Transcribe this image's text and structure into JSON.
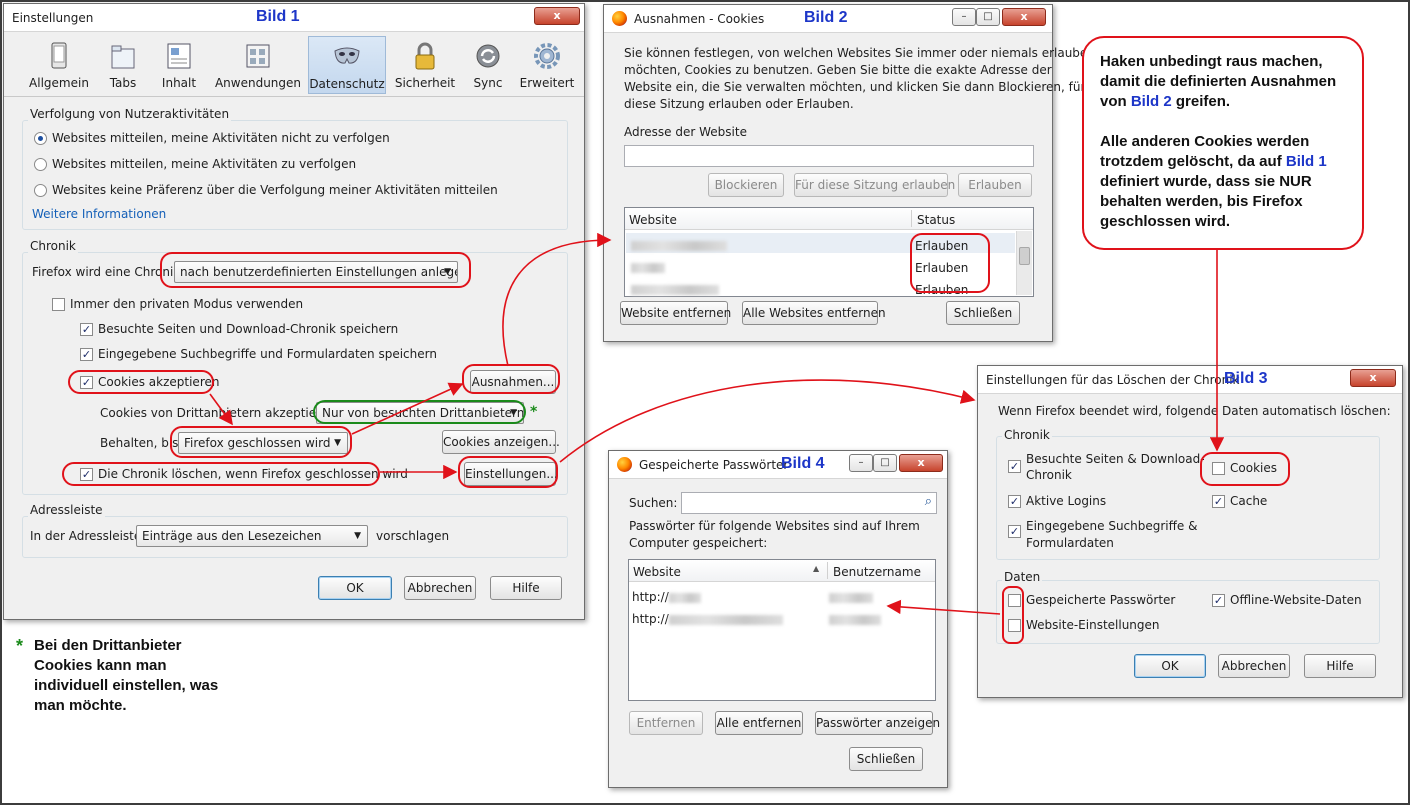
{
  "bild1": {
    "title": "Einstellungen",
    "bild_label": "Bild 1",
    "tabs": [
      {
        "label": "Allgemein",
        "icon": "general-icon"
      },
      {
        "label": "Tabs",
        "icon": "tabs-icon"
      },
      {
        "label": "Inhalt",
        "icon": "content-icon"
      },
      {
        "label": "Anwendungen",
        "icon": "applications-icon"
      },
      {
        "label": "Datenschutz",
        "icon": "privacy-mask-icon"
      },
      {
        "label": "Sicherheit",
        "icon": "lock-icon"
      },
      {
        "label": "Sync",
        "icon": "sync-icon"
      },
      {
        "label": "Erweitert",
        "icon": "gear-icon"
      }
    ],
    "tracking": {
      "group": "Verfolgung von Nutzeraktivitäten",
      "options": [
        "Websites mitteilen, meine Aktivitäten nicht zu verfolgen",
        "Websites mitteilen, meine Aktivitäten zu verfolgen",
        "Websites keine Präferenz über die Verfolgung meiner Aktivitäten mitteilen"
      ],
      "more_info": "Weitere Informationen"
    },
    "history": {
      "group": "Chronik",
      "firefox_will_label": "Firefox wird eine Chronik:",
      "firefox_will_value": "nach benutzerdefinierten Einstellungen anlegen",
      "private_mode": "Immer den privaten Modus verwenden",
      "visited_pages": "Besuchte Seiten und Download-Chronik speichern",
      "search_form": "Eingegebene Suchbegriffe und Formulardaten speichern",
      "accept_cookies": "Cookies akzeptieren",
      "exceptions_button": "Ausnahmen...",
      "third_party_label": "Cookies von Drittanbietern akzeptieren:",
      "third_party_value": "Nur von besuchten Drittanbietern",
      "keep_until_label": "Behalten, bis:",
      "keep_until_value": "Firefox geschlossen wird",
      "show_cookies_button": "Cookies anzeigen...",
      "clear_on_close": "Die Chronik löschen, wenn Firefox geschlossen wird",
      "settings_button": "Einstellungen..."
    },
    "address_bar": {
      "group": "Adressleiste",
      "label": "In der Adressleiste",
      "value": "Einträge aus den Lesezeichen",
      "suffix": "vorschlagen"
    },
    "buttons": {
      "ok": "OK",
      "cancel": "Abbrechen",
      "help": "Hilfe"
    },
    "green_star": "*"
  },
  "bild2": {
    "title": "Ausnahmen - Cookies",
    "bild_label": "Bild 2",
    "description": [
      "Sie können festlegen, von welchen Websites Sie immer oder niemals erlauben",
      "möchten, Cookies zu benutzen. Geben Sie bitte die exakte Adresse der",
      "Website ein, die Sie verwalten möchten, und klicken Sie dann Blockieren, für",
      "diese Sitzung erlauben oder Erlauben."
    ],
    "address_label": "Adresse der Website",
    "buttons": {
      "block": "Blockieren",
      "session": "Für diese Sitzung erlauben",
      "allow": "Erlauben"
    },
    "columns": {
      "website": "Website",
      "status": "Status"
    },
    "rows": [
      {
        "status": "Erlauben"
      },
      {
        "status": "Erlauben"
      },
      {
        "status": "Erlauben"
      }
    ],
    "bottom_buttons": {
      "remove": "Website entfernen",
      "remove_all": "Alle Websites entfernen",
      "close": "Schließen"
    }
  },
  "bild3": {
    "title": "Einstellungen für das Löschen der Chronik",
    "bild_label": "Bild 3",
    "intro": "Wenn Firefox beendet wird, folgende Daten automatisch löschen:",
    "history_group": "Chronik",
    "items": {
      "visited_1": "Besuchte Seiten & Download-",
      "visited_2": "Chronik",
      "cookies": "Cookies",
      "logins": "Aktive Logins",
      "cache": "Cache",
      "search_1": "Eingegebene Suchbegriffe &",
      "search_2": "Formulardaten"
    },
    "data_group": "Daten",
    "data_items": {
      "passwords": "Gespeicherte Passwörter",
      "offline": "Offline-Website-Daten",
      "site_settings": "Website-Einstellungen"
    },
    "buttons": {
      "ok": "OK",
      "cancel": "Abbrechen",
      "help": "Hilfe"
    }
  },
  "bild4": {
    "title": "Gespeicherte Passwörter",
    "bild_label": "Bild 4",
    "search_label": "Suchen:",
    "description_1": "Passwörter für folgende Websites sind auf Ihrem",
    "description_2": "Computer gespeichert:",
    "columns": {
      "website": "Website",
      "username": "Benutzername"
    },
    "rows": [
      {
        "site": "http://"
      },
      {
        "site": "http://"
      }
    ],
    "buttons": {
      "remove": "Entfernen",
      "remove_all": "Alle entfernen",
      "show_passwords": "Passwörter anzeigen",
      "close": "Schließen"
    }
  },
  "annotation": {
    "line1": "Haken unbedingt raus machen,",
    "line2": "damit die definierten Ausnahmen",
    "line3a": "von ",
    "line3b": "Bild 2",
    "line3c": " greifen.",
    "line4": "Alle anderen Cookies werden",
    "line5a": "trotzdem gelöscht, da auf ",
    "line5b": "Bild 1",
    "line6": "definiert wurde, dass sie NUR",
    "line7": "behalten werden, bis Firefox",
    "line8": "geschlossen wird."
  },
  "footnote": {
    "star": "*",
    "line1": "Bei den Drittanbieter",
    "line2": "Cookies kann man",
    "line3": "individuell einstellen, was",
    "line4": "man möchte."
  },
  "colors": {
    "accent_red": "#e0121a",
    "bild_blue": "#1d36c8",
    "green": "#1a8a1a"
  }
}
